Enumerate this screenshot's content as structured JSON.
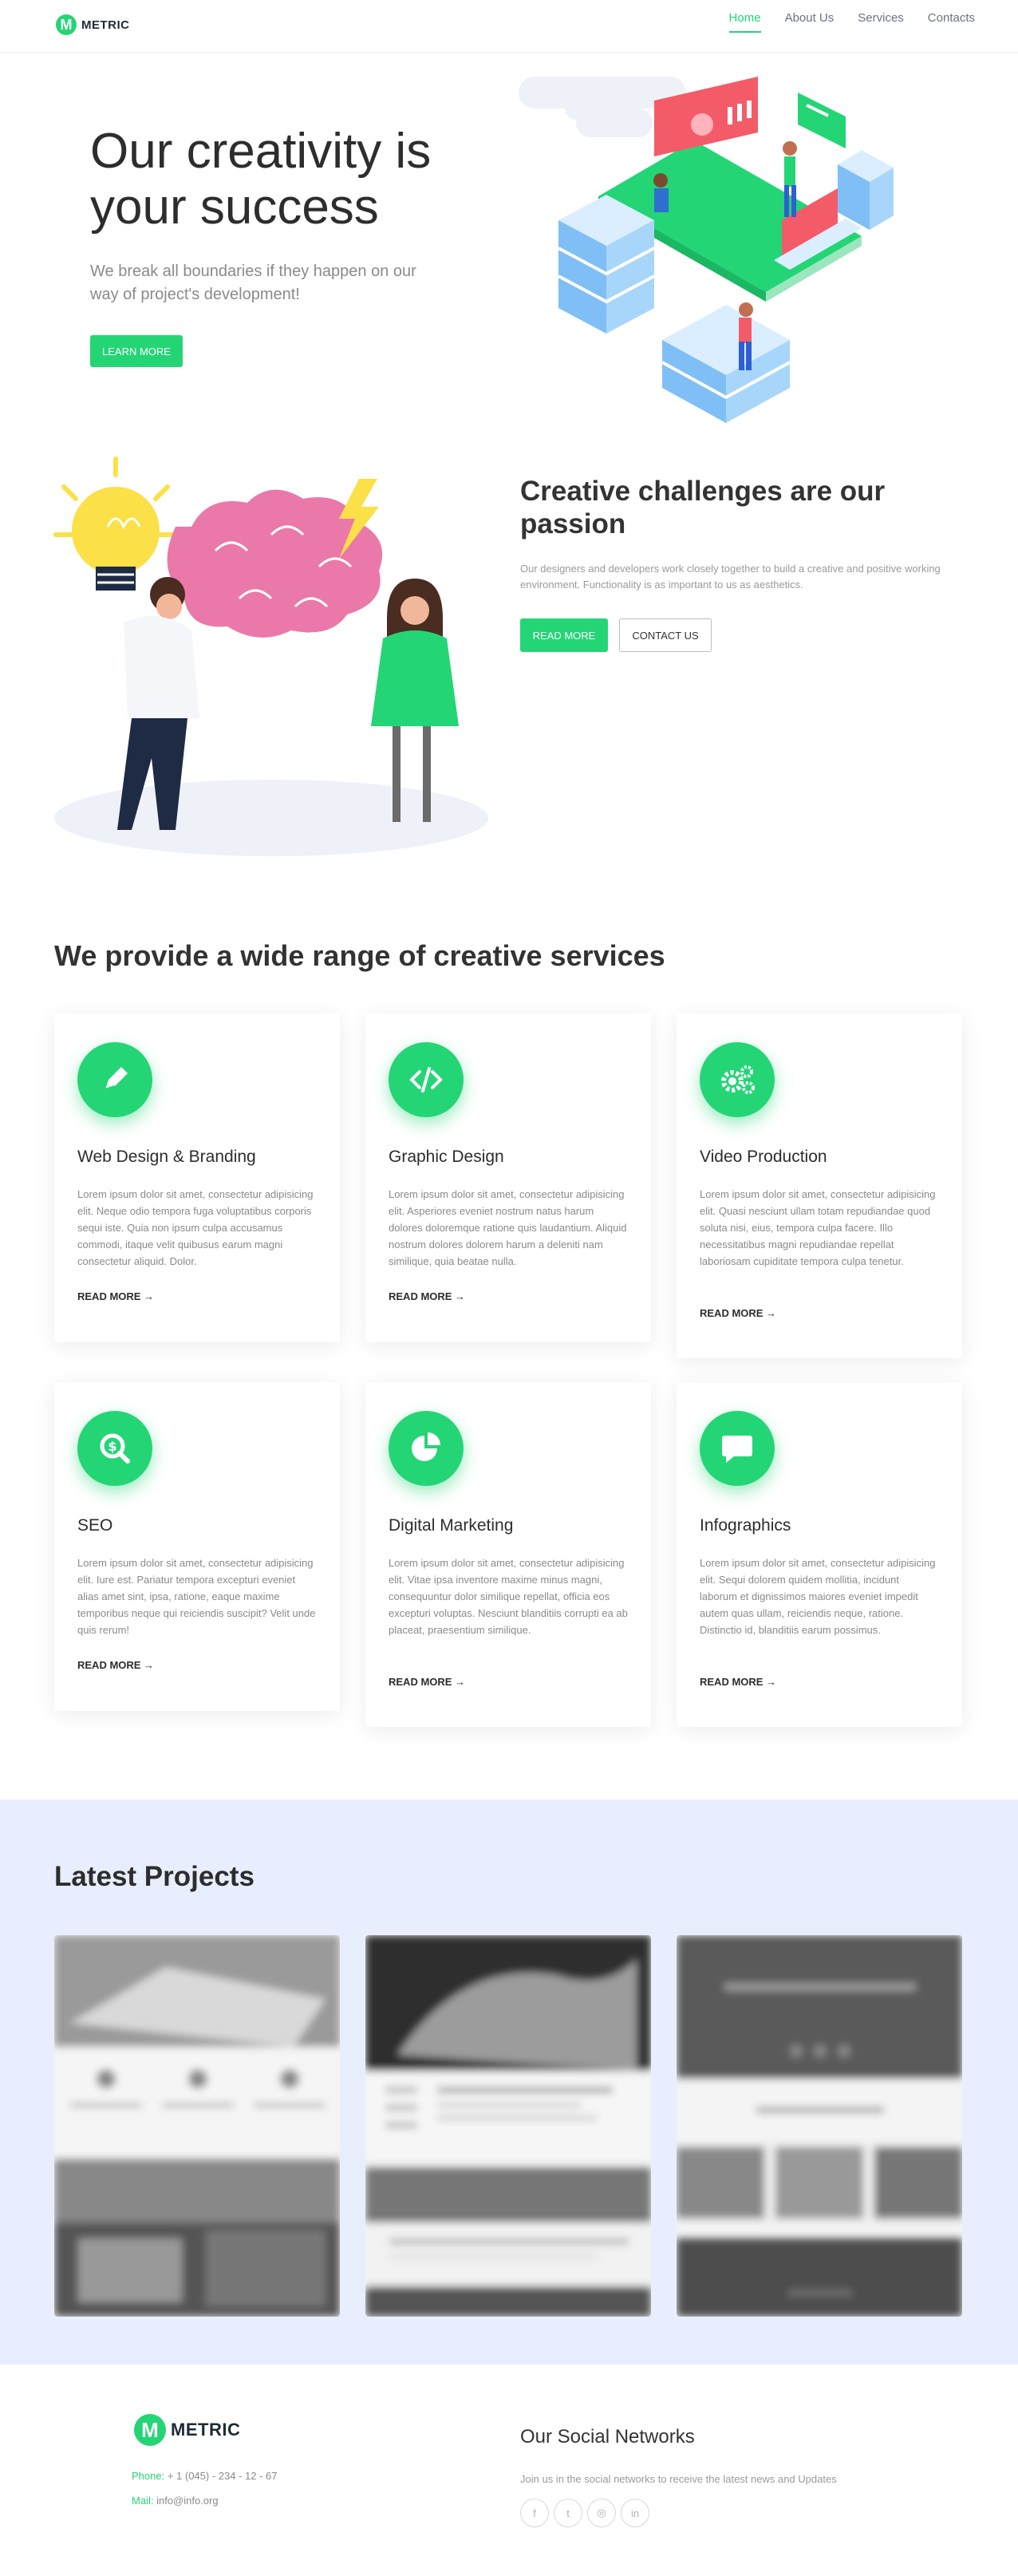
{
  "brand": {
    "name": "METRIC",
    "mark": "M"
  },
  "nav": {
    "items": [
      "Home",
      "About Us",
      "Services",
      "Contacts"
    ],
    "active": 0
  },
  "hero": {
    "title": "Our creativity is your success",
    "subtitle": "We break all boundaries if they happen on our way of project's development!",
    "button": "LEARN MORE"
  },
  "passion": {
    "title": "Creative challenges are our passion",
    "text": "Our designers and developers work closely together to build a creative and positive working environment. Functionality is as important to us as aesthetics.",
    "primary_button": "READ MORE",
    "secondary_button": "CONTACT US"
  },
  "services": {
    "title": "We provide a wide range of creative services",
    "read_more": "READ MORE →",
    "items": [
      {
        "icon": "pencil-icon",
        "title": "Web Design & Branding",
        "text": "Lorem ipsum dolor sit amet, consectetur adipisicing elit. Neque odio tempora fuga voluptatibus corporis sequi iste. Quia non ipsum culpa accusamus commodi, itaque velit quibusus earum magni consectetur aliquid. Dolor."
      },
      {
        "icon": "code-icon",
        "title": "Graphic Design",
        "text": "Lorem ipsum dolor sit amet, consectetur adipisicing elit. Asperiores eveniet nostrum natus harum dolores doloremque ratione quis laudantium. Aliquid nostrum dolores dolorem harum a deleniti nam similique, quia beatae nulla."
      },
      {
        "icon": "gears-icon",
        "title": "Video Production",
        "text": "Lorem ipsum dolor sit amet, consectetur adipisicing elit. Quasi nesciunt ullam totam repudiandae quod soluta nisi, eius, tempora culpa facere. Illo necessitatibus magni repudiandae repellat laboriosam cupiditate tempora culpa tenetur."
      },
      {
        "icon": "search-dollar-icon",
        "title": "SEO",
        "text": "Lorem ipsum dolor sit amet, consectetur adipisicing elit. Iure est. Pariatur tempora excepturi eveniet alias amet sint, ipsa, ratione, eaque maxime temporibus neque qui reiciendis suscipit? Velit unde quis rerum!"
      },
      {
        "icon": "pie-chart-icon",
        "title": "Digital Marketing",
        "text": "Lorem ipsum dolor sit amet, consectetur adipisicing elit. Vitae ipsa inventore maxime minus magni, consequuntur dolor similique repellat, officia eos excepturi voluptas. Nesciunt blanditiis corrupti ea ab placeat, praesentium similique."
      },
      {
        "icon": "comment-icon",
        "title": "Infographics",
        "text": "Lorem ipsum dolor sit amet, consectetur adipisicing elit. Sequi dolorem quidem mollitia, incidunt laborum et dignissimos maiores eveniet impedit autem quas ullam, reiciendis neque, ratione. Distinctio id, blanditiis earum possimus."
      }
    ]
  },
  "projects": {
    "title": "Latest Projects"
  },
  "footer": {
    "phone_label": "Phone:",
    "phone": "+ 1 (045) - 234 - 12 - 67",
    "mail_label": "Mail:",
    "mail": "info@info.org",
    "social_title": "Our Social Networks",
    "social_text": "Join us in the social networks to receive the latest news and Updates",
    "social": [
      {
        "icon": "facebook-icon",
        "glyph": "f"
      },
      {
        "icon": "twitter-icon",
        "glyph": "t"
      },
      {
        "icon": "instagram-icon",
        "glyph": "◎"
      },
      {
        "icon": "linkedin-icon",
        "glyph": "in"
      }
    ]
  },
  "colors": {
    "accent": "#24d576",
    "band": "#e8eefd",
    "brain": "#ea79a9",
    "bulb": "#fbe048"
  }
}
